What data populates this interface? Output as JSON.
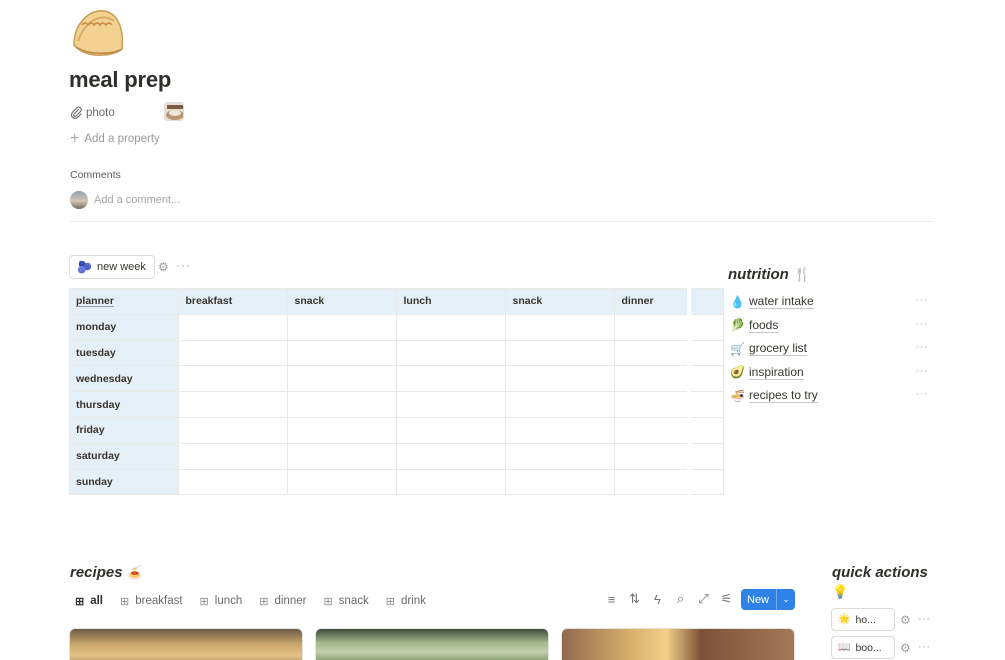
{
  "page": {
    "icon": "dumpling-icon",
    "title": "meal prep"
  },
  "properties": {
    "photo_label": "photo",
    "add_property": "Add a property"
  },
  "comments": {
    "label": "Comments",
    "placeholder": "Add a comment..."
  },
  "planner": {
    "button_label": "new week",
    "button_emoji": "🫐",
    "columns": [
      "planner",
      "breakfast",
      "snack",
      "lunch",
      "snack",
      "dinner"
    ],
    "rows": [
      "monday",
      "tuesday",
      "wednesday",
      "thursday",
      "friday",
      "saturday",
      "sunday"
    ]
  },
  "nutrition": {
    "title": "nutrition",
    "title_icon": "🍴",
    "items": [
      {
        "emoji": "💧",
        "label": "water intake"
      },
      {
        "emoji": "🥬",
        "label": "foods"
      },
      {
        "emoji": "🛒",
        "label": "grocery list"
      },
      {
        "emoji": "🥑",
        "label": "inspiration"
      },
      {
        "emoji": "🍜",
        "label": "recipes to try"
      }
    ]
  },
  "recipes": {
    "title": "recipes",
    "title_emoji": "🍝",
    "tabs": [
      "all",
      "breakfast",
      "lunch",
      "dinner",
      "snack",
      "drink"
    ],
    "new_label": "New"
  },
  "quick_actions": {
    "title": "quick actions",
    "title_emoji": "💡",
    "buttons": [
      {
        "emoji": "🌟",
        "label": "ho..."
      },
      {
        "emoji": "📖",
        "label": "boo..."
      }
    ]
  }
}
